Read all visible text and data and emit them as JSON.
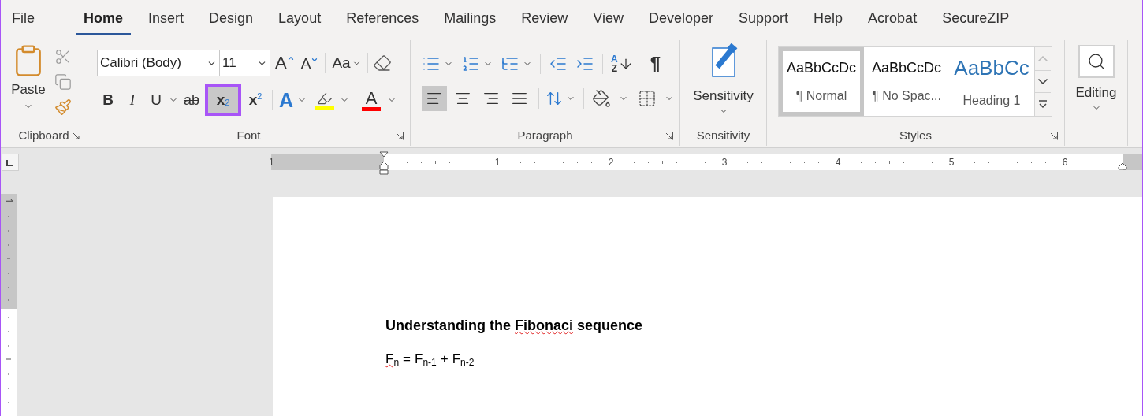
{
  "tabs": [
    {
      "label": "File",
      "selected": false
    },
    {
      "label": "Home",
      "selected": true
    },
    {
      "label": "Insert",
      "selected": false
    },
    {
      "label": "Design",
      "selected": false
    },
    {
      "label": "Layout",
      "selected": false
    },
    {
      "label": "References",
      "selected": false
    },
    {
      "label": "Mailings",
      "selected": false
    },
    {
      "label": "Review",
      "selected": false
    },
    {
      "label": "View",
      "selected": false
    },
    {
      "label": "Developer",
      "selected": false
    },
    {
      "label": "Support",
      "selected": false
    },
    {
      "label": "Help",
      "selected": false
    },
    {
      "label": "Acrobat",
      "selected": false
    },
    {
      "label": "SecureZIP",
      "selected": false
    }
  ],
  "clipboard": {
    "paste": "Paste",
    "group": "Clipboard"
  },
  "font": {
    "name": "Calibri (Body)",
    "size": "11",
    "grow": "A",
    "shrink": "A",
    "case": "Aa",
    "bold": "B",
    "italic": "I",
    "underline": "U",
    "strike": "ab",
    "scripts": [
      {
        "kind": "subscript",
        "base": "x",
        "mark": "2",
        "selected": true
      },
      {
        "kind": "superscript",
        "base": "x",
        "mark": "2",
        "selected": false
      }
    ],
    "effects": "A",
    "color_letter": "A",
    "group": "Font"
  },
  "paragraph": {
    "sort_top": "A",
    "sort_bottom": "Z",
    "pilcrow": "¶",
    "alignments": [
      {
        "kind": "left",
        "selected": true
      },
      {
        "kind": "center",
        "selected": false
      },
      {
        "kind": "right",
        "selected": false
      },
      {
        "kind": "justify",
        "selected": false
      }
    ],
    "group": "Paragraph"
  },
  "sensitivity": {
    "label": "Sensitivity",
    "group": "Sensitivity"
  },
  "styles": {
    "items": [
      {
        "kind": "body",
        "sample": "AaBbCcDc",
        "name": "¶ Normal",
        "selected": true
      },
      {
        "kind": "body",
        "sample": "AaBbCcDc",
        "name": "¶ No Spac...",
        "selected": false
      },
      {
        "kind": "heading",
        "sample": "AaBbCc",
        "name": "Heading 1",
        "selected": false
      }
    ],
    "group": "Styles"
  },
  "editing": {
    "label": "Editing"
  },
  "ruler": {
    "left_number": "1",
    "numbers": [
      "1",
      "2",
      "3",
      "4",
      "5",
      "6"
    ]
  },
  "vertical_ruler": {
    "number": "1"
  },
  "document": {
    "heading": [
      {
        "text": "Understanding the ",
        "misspelled": false
      },
      {
        "text": "Fibonaci",
        "misspelled": true
      },
      {
        "text": " sequence",
        "misspelled": false
      }
    ],
    "formula": [
      {
        "kind": "term",
        "base": "F",
        "sub": "n",
        "misspelled": true
      },
      {
        "kind": "operator",
        "text": "="
      },
      {
        "kind": "term",
        "base": "F",
        "sub": "n-1",
        "misspelled": false
      },
      {
        "kind": "operator",
        "text": "+"
      },
      {
        "kind": "term",
        "base": "F",
        "sub": "n-2",
        "misspelled": false
      }
    ]
  }
}
